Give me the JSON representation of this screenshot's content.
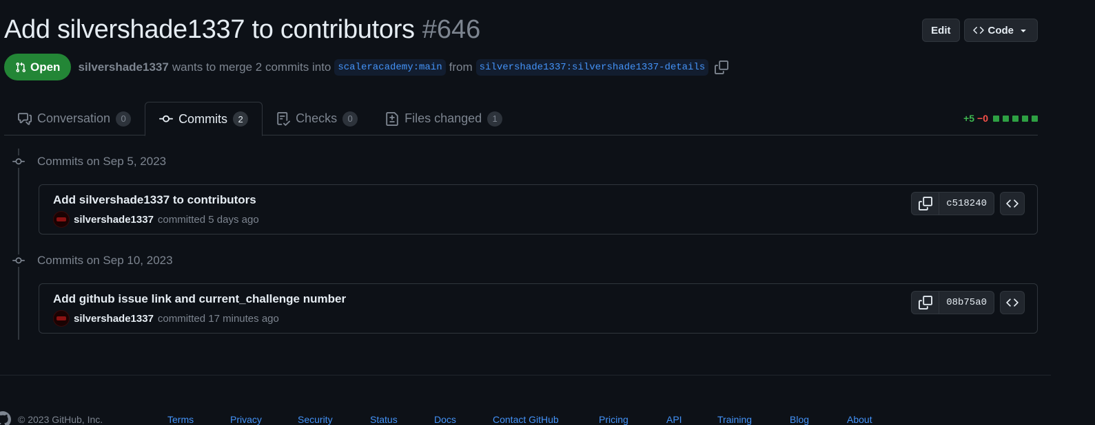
{
  "header": {
    "title": "Add silvershade1337 to contributors",
    "number": "#646",
    "edit_label": "Edit",
    "code_label": "Code"
  },
  "meta": {
    "state": "Open",
    "author": "silvershade1337",
    "text_before": "wants to merge 2 commits into",
    "base_branch": "scaleracademy:main",
    "text_from": "from",
    "head_branch": "silvershade1337:silvershade1337-details"
  },
  "tabs": [
    {
      "label": "Conversation",
      "count": "0"
    },
    {
      "label": "Commits",
      "count": "2"
    },
    {
      "label": "Checks",
      "count": "0"
    },
    {
      "label": "Files changed",
      "count": "1"
    }
  ],
  "diffstat": {
    "additions": "+5",
    "deletions": "−0"
  },
  "commit_groups": [
    {
      "label": "Commits on Sep 5, 2023",
      "commit": {
        "title": "Add silvershade1337 to contributors",
        "author": "silvershade1337",
        "when": "committed 5 days ago",
        "sha": "c518240"
      }
    },
    {
      "label": "Commits on Sep 10, 2023",
      "commit": {
        "title": "Add github issue link and current_challenge number",
        "author": "silvershade1337",
        "when": "committed 17 minutes ago",
        "sha": "08b75a0"
      }
    }
  ],
  "footer": {
    "copyright": "© 2023 GitHub, Inc.",
    "links": [
      "Terms",
      "Privacy",
      "Security",
      "Status",
      "Docs",
      "Contact GitHub",
      "Pricing",
      "API",
      "Training",
      "Blog",
      "About"
    ]
  },
  "colors": {
    "background": "#0d1117",
    "open_badge": "#238636",
    "link": "#4493f8",
    "additions": "#3fb950",
    "deletions": "#f85149"
  }
}
